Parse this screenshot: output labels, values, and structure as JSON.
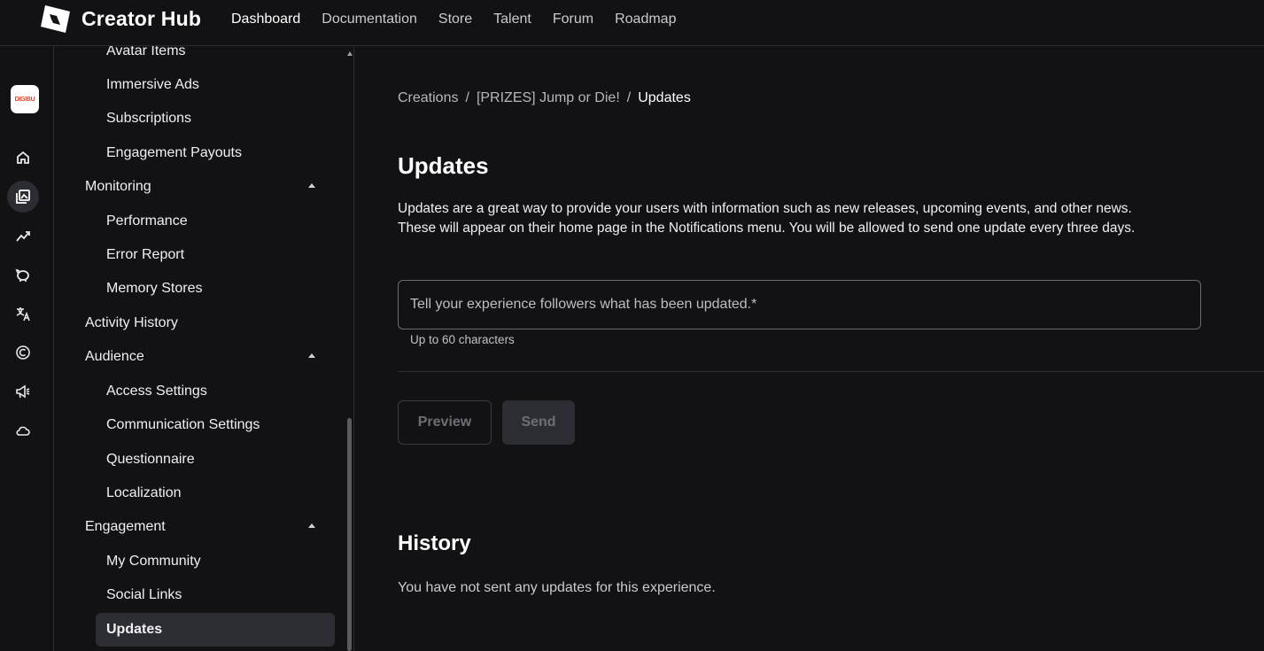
{
  "header": {
    "brand": "Creator Hub",
    "nav": [
      "Dashboard",
      "Documentation",
      "Store",
      "Talent",
      "Forum",
      "Roadmap"
    ],
    "active_nav": "Dashboard"
  },
  "rail": {
    "avatar_text": "DIGIBU",
    "icons": [
      "home-icon",
      "creations-icon",
      "analytics-icon",
      "monetization-icon",
      "translate-icon",
      "copyright-icon",
      "announce-icon",
      "cloud-icon"
    ],
    "active": "creations-icon"
  },
  "sidebar": {
    "items": [
      {
        "label": "Avatar Items",
        "level": 2
      },
      {
        "label": "Immersive Ads",
        "level": 2
      },
      {
        "label": "Subscriptions",
        "level": 2
      },
      {
        "label": "Engagement Payouts",
        "level": 2
      },
      {
        "label": "Monitoring",
        "level": 1,
        "expanded": true
      },
      {
        "label": "Performance",
        "level": 2
      },
      {
        "label": "Error Report",
        "level": 2
      },
      {
        "label": "Memory Stores",
        "level": 2
      },
      {
        "label": "Activity History",
        "level": 1
      },
      {
        "label": "Audience",
        "level": 1,
        "expanded": true
      },
      {
        "label": "Access Settings",
        "level": 2
      },
      {
        "label": "Communication Settings",
        "level": 2
      },
      {
        "label": "Questionnaire",
        "level": 2
      },
      {
        "label": "Localization",
        "level": 2
      },
      {
        "label": "Engagement",
        "level": 1,
        "expanded": true
      },
      {
        "label": "My Community",
        "level": 2
      },
      {
        "label": "Social Links",
        "level": 2
      },
      {
        "label": "Updates",
        "level": 2,
        "active": true
      }
    ]
  },
  "main": {
    "breadcrumb": [
      "Creations",
      "[PRIZES] Jump or Die!",
      "Updates"
    ],
    "breadcrumb_separator": "/",
    "title": "Updates",
    "description_line1": "Updates are a great way to provide your users with information such as new releases, upcoming events, and other news.",
    "description_line2": "These will appear on their home page in the Notifications menu. You will be allowed to send one update every three days.",
    "input_placeholder": "Tell your experience followers what has been updated.*",
    "input_value": "",
    "input_hint": "Up to 60 characters",
    "preview_label": "Preview",
    "send_label": "Send",
    "history_title": "History",
    "history_empty": "You have not sent any updates for this experience."
  },
  "colors": {
    "background": "#121215",
    "active_item": "#2c2d33",
    "border": "#2a2b30"
  }
}
